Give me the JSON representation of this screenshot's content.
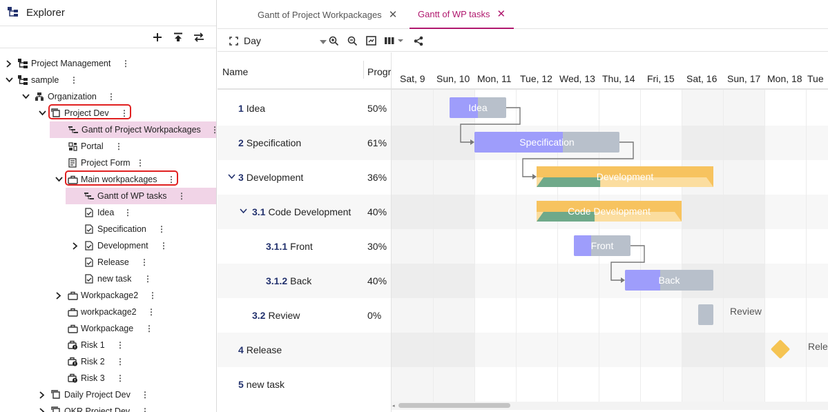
{
  "explorer": {
    "title": "Explorer",
    "items": [
      {
        "label": "Project Management"
      },
      {
        "label": "sample"
      },
      {
        "label": "Organization"
      },
      {
        "label": "Project Dev"
      },
      {
        "label": "Gantt of Project Workpackages"
      },
      {
        "label": "Portal"
      },
      {
        "label": "Project Form"
      },
      {
        "label": "Main workpackages"
      },
      {
        "label": "Gantt of WP tasks"
      },
      {
        "label": "Idea"
      },
      {
        "label": "Specification"
      },
      {
        "label": "Development"
      },
      {
        "label": "Release"
      },
      {
        "label": "new task"
      },
      {
        "label": "Workpackage2"
      },
      {
        "label": "workpackage2"
      },
      {
        "label": "Workpackage"
      },
      {
        "label": "Risk 1"
      },
      {
        "label": "Risk 2"
      },
      {
        "label": "Risk 3"
      },
      {
        "label": "Daily Project Dev"
      },
      {
        "label": "OKR Project Dev"
      }
    ]
  },
  "tabs": [
    {
      "label": "Gantt of Project Workpackages",
      "active": false
    },
    {
      "label": "Gantt of WP tasks",
      "active": true
    }
  ],
  "gantt_toolbar": {
    "scale": "Day"
  },
  "grid": {
    "col_name": "Name",
    "col_progress": "Progr",
    "rows": [
      {
        "num": "1",
        "name": "Idea",
        "progress": "50%"
      },
      {
        "num": "2",
        "name": "Specification",
        "progress": "61%"
      },
      {
        "num": "3",
        "name": "Development",
        "progress": "36%"
      },
      {
        "num": "3.1",
        "name": "Code Development",
        "progress": "40%"
      },
      {
        "num": "3.1.1",
        "name": "Front",
        "progress": "30%"
      },
      {
        "num": "3.1.2",
        "name": "Back",
        "progress": "40%"
      },
      {
        "num": "3.2",
        "name": "Review",
        "progress": "0%"
      },
      {
        "num": "4",
        "name": "Release",
        "progress": ""
      },
      {
        "num": "5",
        "name": "new task",
        "progress": ""
      }
    ]
  },
  "timeline": {
    "days": [
      "Sat, 9",
      "Sun, 10",
      "Mon, 11",
      "Tue, 12",
      "Wed, 13",
      "Thu, 14",
      "Fri, 15",
      "Sat, 16",
      "Sun, 17",
      "Mon, 18",
      "Tue"
    ],
    "bars": {
      "idea": "Idea",
      "spec": "Specification",
      "dev": "Development",
      "code": "Code Development",
      "front": "Front",
      "back": "Back",
      "review": "Review",
      "release": "Rele"
    },
    "progress": {
      "idea": 0.5,
      "spec": 0.61,
      "dev": 0.36,
      "code": 0.4,
      "front": 0.3,
      "back": 0.4,
      "review": 0
    }
  },
  "colors": {
    "accent": "#b0186e",
    "task_fill": "#9e9dfb",
    "task_bg": "#b8c0cb",
    "summary": "#f7c35f",
    "summary_progress": "#6fa98a",
    "milestone": "#f5c453",
    "highlight_box": "#e02020"
  }
}
